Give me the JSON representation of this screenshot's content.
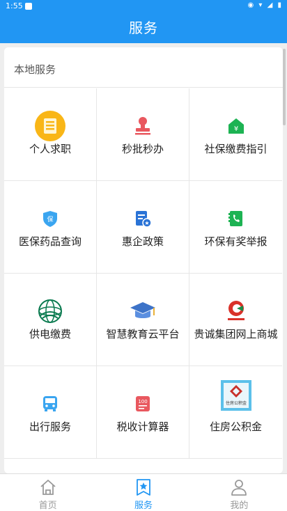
{
  "status": {
    "time": "1:55"
  },
  "header": {
    "title": "服务"
  },
  "section": {
    "title": "本地服务"
  },
  "services": [
    {
      "label": "个人求职",
      "icon": "job-search-icon"
    },
    {
      "label": "秒批秒办",
      "icon": "stamp-icon"
    },
    {
      "label": "社保缴费指引",
      "icon": "social-security-icon"
    },
    {
      "label": "医保药品查询",
      "icon": "medical-insurance-icon"
    },
    {
      "label": "惠企政策",
      "icon": "policy-document-icon"
    },
    {
      "label": "环保有奖举报",
      "icon": "phone-report-icon"
    },
    {
      "label": "供电缴费",
      "icon": "power-grid-logo-icon"
    },
    {
      "label": "智慧教育云平台",
      "icon": "graduation-cap-icon"
    },
    {
      "label": "贵诚集团网上商城",
      "icon": "guicheng-logo-icon"
    },
    {
      "label": "出行服务",
      "icon": "bus-icon"
    },
    {
      "label": "税收计算器",
      "icon": "tax-calculator-icon"
    },
    {
      "label": "住房公积金",
      "icon": "housing-fund-icon"
    }
  ],
  "housing_fund_logo_text": "住房公积金",
  "tax_badge_text": "100",
  "bottom_nav": [
    {
      "label": "首页",
      "icon": "home-icon",
      "active": false
    },
    {
      "label": "服务",
      "icon": "service-star-icon",
      "active": true
    },
    {
      "label": "我的",
      "icon": "profile-icon",
      "active": false
    }
  ],
  "colors": {
    "primary": "#2196f3",
    "inactive": "#999999"
  }
}
